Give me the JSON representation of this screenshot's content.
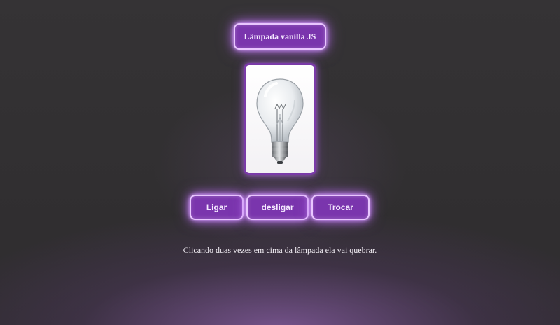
{
  "header": {
    "title": "Lâmpada vanilla JS"
  },
  "bulb": {
    "image_icon": "lightbulb-off-icon"
  },
  "controls": [
    {
      "label": "Ligar"
    },
    {
      "label": "desligar"
    },
    {
      "label": "Trocar"
    }
  ],
  "hint": {
    "text": "Clicando duas vezes em cima da lâmpada ela vai quebrar."
  },
  "colors": {
    "background": "#323032",
    "button_fill": "#7a35ad",
    "button_glow": "#d9a6ff",
    "card_border": "#7a3aa8"
  }
}
